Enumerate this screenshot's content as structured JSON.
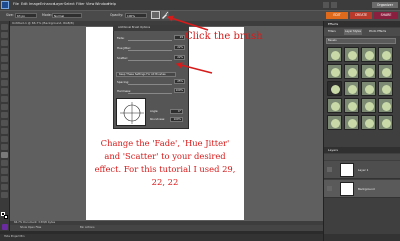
{
  "menubar": {
    "items": [
      "File",
      "Edit",
      "Image",
      "Enhance",
      "Layer",
      "Select",
      "Filter",
      "View",
      "Window",
      "Help"
    ],
    "organizer_label": "Organizer"
  },
  "optionsbar": {
    "size_label": "Size:",
    "size_value": "63 px",
    "mode_label": "Mode:",
    "mode_value": "Normal",
    "opacity_label": "Opacity:",
    "opacity_value": "100%"
  },
  "mode_tabs": [
    "EDIT",
    "CREATE",
    "SHARE"
  ],
  "document": {
    "title": "Untitled-1 @ 66.7% (Background, RGB/8)",
    "status": "66.7%    Document: 3.5M/0 bytes",
    "bin_label": "Show Open Files",
    "bin_actions": "Bin Actions"
  },
  "brush_popup": {
    "title": "Additional Brush Options",
    "rows": [
      {
        "label": "Fade:",
        "value": "29"
      },
      {
        "label": "Hue Jitter:",
        "value": "22%"
      },
      {
        "label": "Scatter:",
        "value": "22%"
      }
    ],
    "keep_label": "Keep These Settings For All Brushes",
    "spacing_label": "Spacing:",
    "spacing_value": "25%",
    "hardness_label": "Hardness:",
    "hardness_value": "100%",
    "angle_label": "Angle:",
    "angle_value": "0°",
    "roundness_label": "Roundness:",
    "roundness_value": "100%"
  },
  "annotations": {
    "click_text": "Click  the brush",
    "instruction": "Change the 'Fade', 'Hue Jitter'  and 'Scatter' to your desired effect. For this tutorial I used 29, 22, 22"
  },
  "effects_panel": {
    "title": "Effects",
    "tabs": [
      "Filters",
      "Layer Styles",
      "Photo Effects"
    ],
    "select_value": "Bevels"
  },
  "layers_panel": {
    "title": "Layers",
    "layers": [
      "Layer 1",
      "Background"
    ]
  },
  "project_bin": {
    "label": "Hide Project Bin"
  },
  "colors": {
    "accent_red": "#d71a1a",
    "edit_tab": "#e06a1c",
    "create_tab": "#b93a2a",
    "share_tab": "#8a2040"
  }
}
